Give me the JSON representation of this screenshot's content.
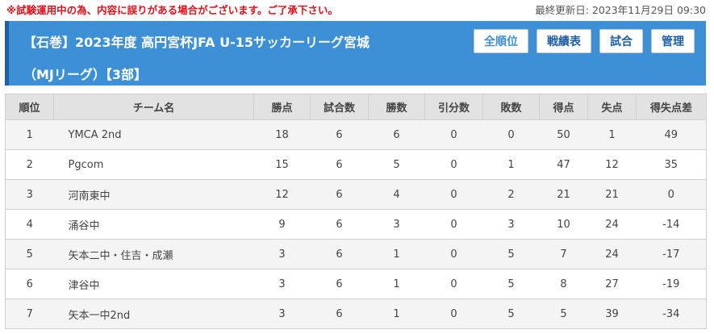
{
  "notice": "※試験運用中の為、内容に誤りがある場合がございます。ご了承下さい。",
  "last_updated": "最終更新日: 2023年11月29日 09:30",
  "header": {
    "title_line1": "【石巻】2023年度 高円宮杯JFA U-15サッカーリーグ宮城",
    "title_line2": "（MJリーグ）【3部】"
  },
  "nav": {
    "standings": "全順位",
    "results": "戦績表",
    "matches": "試合",
    "admin": "管理"
  },
  "table": {
    "headers": [
      "順位",
      "チーム名",
      "勝点",
      "試合数",
      "勝数",
      "引分数",
      "敗数",
      "得点",
      "失点",
      "得失点差"
    ],
    "rows": [
      [
        "1",
        "YMCA 2nd",
        "18",
        "6",
        "6",
        "0",
        "0",
        "50",
        "1",
        "49"
      ],
      [
        "2",
        "Pgcom",
        "15",
        "6",
        "5",
        "0",
        "1",
        "47",
        "12",
        "35"
      ],
      [
        "3",
        "河南東中",
        "12",
        "6",
        "4",
        "0",
        "2",
        "21",
        "21",
        "0"
      ],
      [
        "4",
        "涌谷中",
        "9",
        "6",
        "3",
        "0",
        "3",
        "10",
        "24",
        "-14"
      ],
      [
        "5",
        "矢本二中・住吉・成瀬",
        "3",
        "6",
        "1",
        "0",
        "5",
        "7",
        "24",
        "-17"
      ],
      [
        "6",
        "津谷中",
        "3",
        "6",
        "1",
        "0",
        "5",
        "8",
        "27",
        "-19"
      ],
      [
        "7",
        "矢本一中2nd",
        "3",
        "6",
        "1",
        "0",
        "5",
        "5",
        "39",
        "-34"
      ]
    ]
  }
}
